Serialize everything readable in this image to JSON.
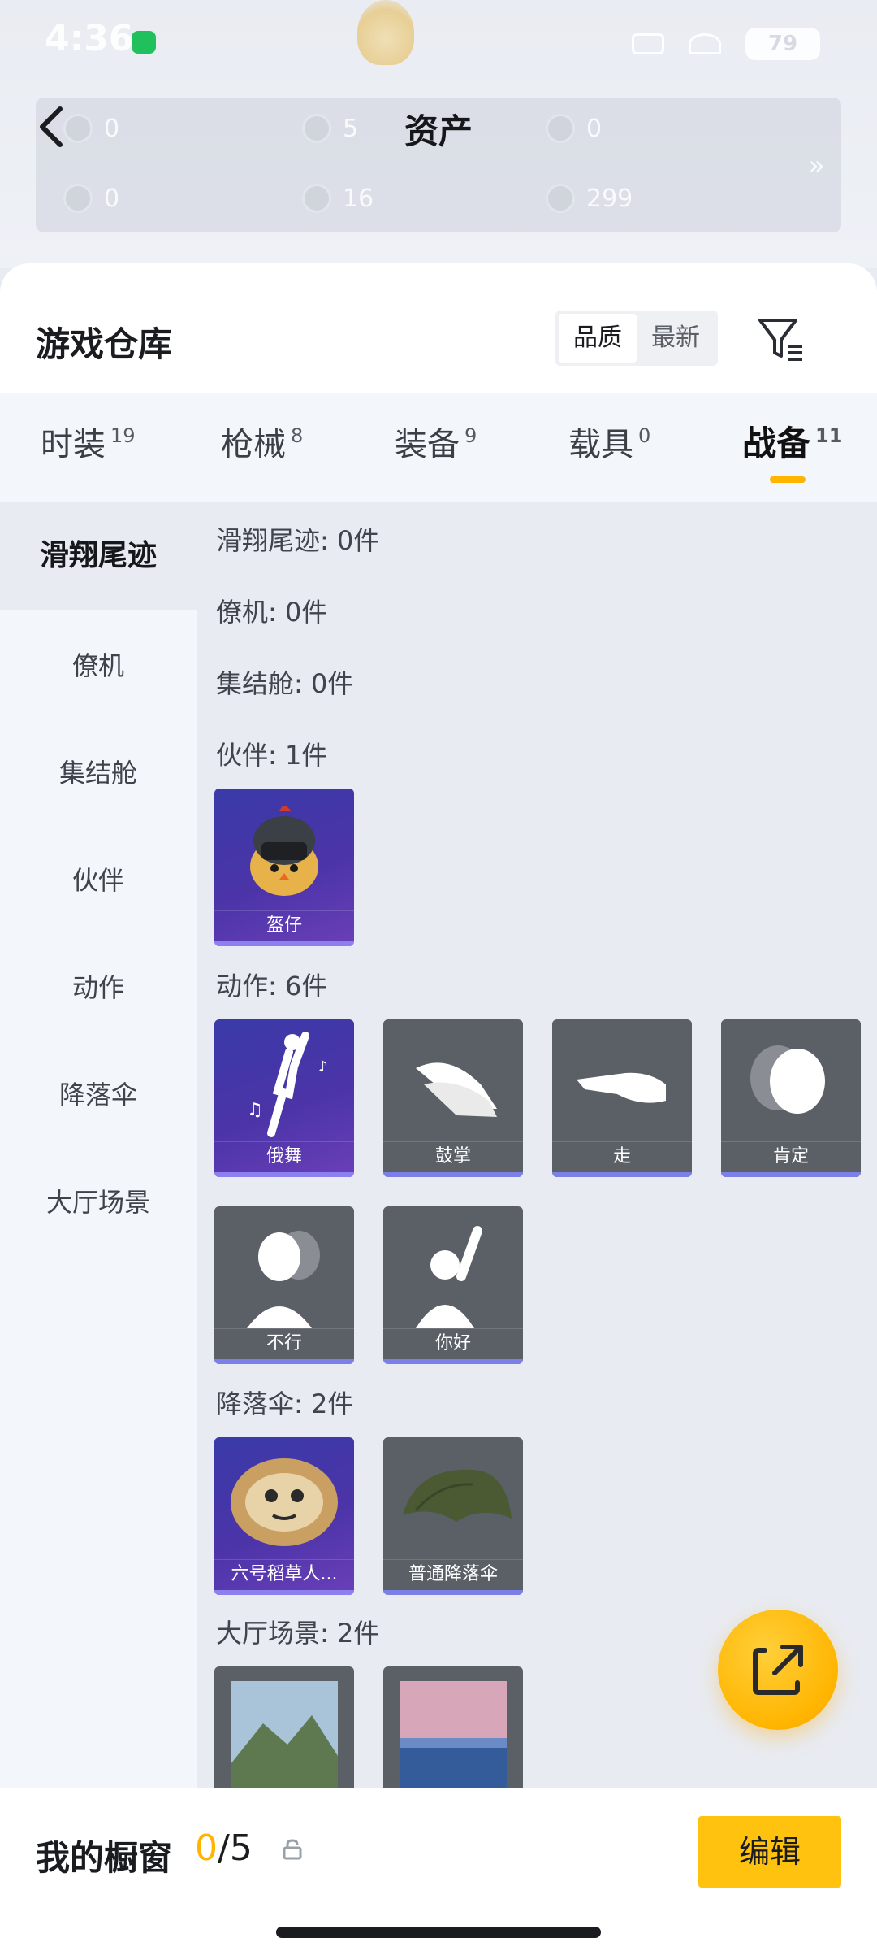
{
  "status_bar": {
    "time": "4:36",
    "battery": "79"
  },
  "assets": {
    "title": "资产",
    "items": [
      {
        "value": "0"
      },
      {
        "value": "5"
      },
      {
        "value": "0"
      },
      {
        "value": "0"
      },
      {
        "value": "16"
      },
      {
        "value": "299"
      }
    ],
    "more": "»"
  },
  "warehouse": {
    "title": "游戏仓库",
    "sort_options": [
      "品质",
      "最新"
    ],
    "active_sort": "品质"
  },
  "tabs": [
    {
      "label": "时装",
      "count": "19"
    },
    {
      "label": "枪械",
      "count": "8"
    },
    {
      "label": "装备",
      "count": "9"
    },
    {
      "label": "载具",
      "count": "0"
    },
    {
      "label": "战备",
      "count": "11",
      "active": true
    }
  ],
  "side_categories": [
    "滑翔尾迹",
    "僚机",
    "集结舱",
    "伙伴",
    "动作",
    "降落伞",
    "大厅场景"
  ],
  "sections": {
    "glide": "滑翔尾迹: 0件",
    "wingman": "僚机: 0件",
    "rally": "集结舱: 0件",
    "partner": "伙伴: 1件",
    "emote": "动作: 6件",
    "parachute": "降落伞: 2件",
    "lobby": "大厅场景: 2件"
  },
  "items": {
    "partner": [
      {
        "name": "盔仔",
        "style": "purple"
      }
    ],
    "emote": [
      {
        "name": "俄舞",
        "style": "purple"
      },
      {
        "name": "鼓掌",
        "style": "gray"
      },
      {
        "name": "走",
        "style": "gray"
      },
      {
        "name": "肯定",
        "style": "gray"
      },
      {
        "name": "不行",
        "style": "gray"
      },
      {
        "name": "你好",
        "style": "gray"
      }
    ],
    "parachute": [
      {
        "name": "六号稻草人...",
        "style": "purple"
      },
      {
        "name": "普通降落伞",
        "style": "gray"
      }
    ]
  },
  "bottom": {
    "title": "我的橱窗",
    "current": "0",
    "total": "/5",
    "edit": "编辑"
  },
  "colors": {
    "accent": "#ffb400",
    "rare": "#4b34a8",
    "common": "#5b5f66"
  }
}
